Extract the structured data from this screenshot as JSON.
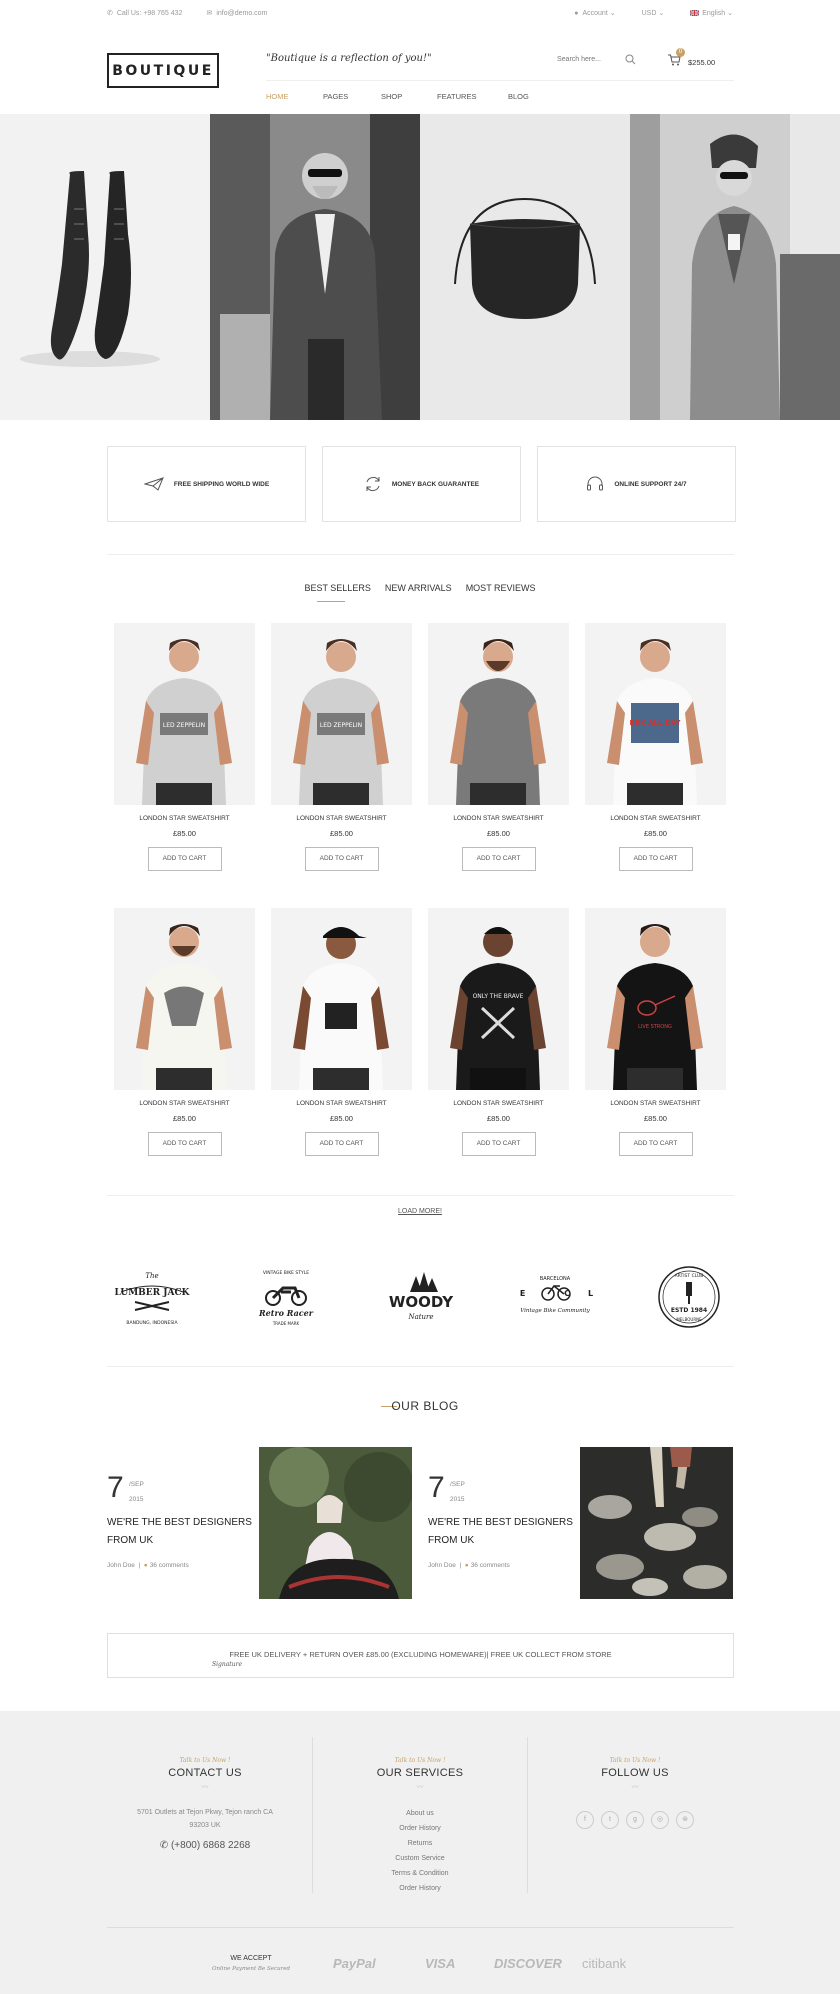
{
  "topbar": {
    "call": "Call Us: +98 765 432",
    "email": "info@demo.com",
    "account": "Account",
    "currency": "USD",
    "language": "English"
  },
  "header": {
    "logo": "BOUTIQUE",
    "tagline": "\"Boutique is a reflection of you!\"",
    "search_placeholder": "Search here...",
    "cart_count": "0",
    "cart_total": "$255.00",
    "nav": [
      "HOME",
      "PAGES",
      "SHOP",
      "FEATURES",
      "BLOG"
    ]
  },
  "features": [
    "FREE SHIPPING WORLD WIDE",
    "MONEY BACK GUARANTEE",
    "ONLINE SUPPORT 24/7"
  ],
  "tabs": [
    "BEST SELLERS",
    "NEW ARRIVALS",
    "MOST REVIEWS"
  ],
  "products": [
    {
      "name": "LONDON STAR SWEATSHIRT",
      "price": "£85.00",
      "cta": "ADD TO CART",
      "print": "LED ZEPPELIN"
    },
    {
      "name": "LONDON STAR SWEATSHIRT",
      "price": "£85.00",
      "cta": "ADD TO CART",
      "print": "LED ZEPPELIN"
    },
    {
      "name": "LONDON STAR SWEATSHIRT",
      "price": "£85.00",
      "cta": "ADD TO CART",
      "print": ""
    },
    {
      "name": "LONDON STAR SWEATSHIRT",
      "price": "£85.00",
      "cta": "ADD TO CART",
      "print": "BRK ALL DAY"
    },
    {
      "name": "LONDON STAR SWEATSHIRT",
      "price": "£85.00",
      "cta": "ADD TO CART",
      "print": ""
    },
    {
      "name": "LONDON STAR SWEATSHIRT",
      "price": "£85.00",
      "cta": "ADD TO CART",
      "print": ""
    },
    {
      "name": "LONDON STAR SWEATSHIRT",
      "price": "£85.00",
      "cta": "ADD TO CART",
      "print": "ONLY THE BRAVE"
    },
    {
      "name": "LONDON STAR SWEATSHIRT",
      "price": "£85.00",
      "cta": "ADD TO CART",
      "print": "LIVE STRONG"
    }
  ],
  "load_more": "LOAD MORE!",
  "brands": [
    {
      "top": "The",
      "main": "LUMBER JACK",
      "bottom": "BANDUNG, INDONESIA"
    },
    {
      "top": "VINTAGE BIKE STYLE",
      "main": "Retro Racer",
      "bottom": "TRADE MARK"
    },
    {
      "top": "",
      "main": "WOODY",
      "bottom": "Nature"
    },
    {
      "top": "BARCELONA",
      "main": "BIKE CLUB",
      "bottom": "Vintage Bike Community"
    },
    {
      "top": "ARTIST CLUB",
      "main": "ESTD 1984",
      "bottom": "MELBOURNE"
    }
  ],
  "blog": {
    "title": "OUR BLOG",
    "posts": [
      {
        "day": "7",
        "month": "/SEP",
        "year": "2015",
        "title": "WE'RE THE BEST DESIGNERS FROM UK",
        "author": "John Doe",
        "comments": "36 comments"
      },
      {
        "day": "7",
        "month": "/SEP",
        "year": "2015",
        "title": "WE'RE THE BEST DESIGNERS FROM UK",
        "author": "John Doe",
        "comments": "36 comments"
      }
    ]
  },
  "delivery": {
    "text": "FREE UK DELIVERY + RETURN OVER £85.00 (EXCLUDING HOMEWARE)| FREE UK COLLECT FROM STORE",
    "signature": "Signature"
  },
  "footer": {
    "talk": "Talk to Us Now !",
    "contact": {
      "title": "CONTACT US",
      "address": "5701 Outlets at Tejon Pkwy, Tejon ranch CA 93203 UK",
      "phone": "(+800) 6868 2268"
    },
    "services": {
      "title": "OUR SERVICES",
      "links": [
        "About us",
        "Order History",
        "Returns",
        "Custom Service",
        "Terms & Condition",
        "Order History"
      ]
    },
    "follow": {
      "title": "FOLLOW US",
      "social": [
        "facebook-icon",
        "twitter-icon",
        "google-plus-icon",
        "instagram-icon",
        "dribbble-icon"
      ]
    },
    "we_accept": "WE ACCEPT",
    "secured": "Online Payment Be Secured",
    "payments": [
      "PayPal",
      "VISA",
      "DISCOVER",
      "citibank"
    ]
  },
  "colors": {
    "accent": "#c8a165",
    "footer_bg": "#f0f0f0",
    "border": "#e2e2e2"
  }
}
